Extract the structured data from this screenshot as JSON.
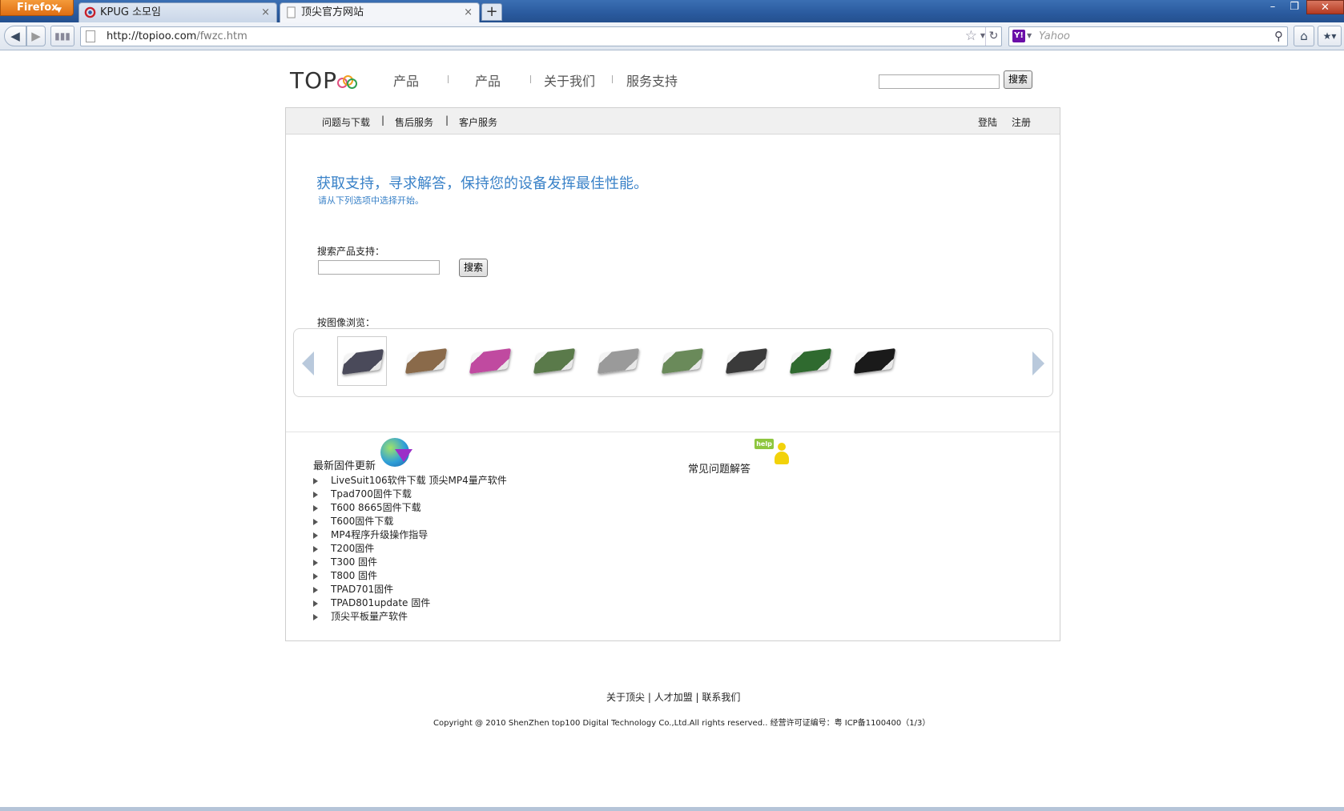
{
  "browser": {
    "menu_button": "Firefox",
    "tabs": [
      {
        "title": "KPUG 소모임",
        "active": false
      },
      {
        "title": "顶尖官方网站",
        "active": true
      }
    ],
    "new_tab": "+",
    "url_host": "http://topioo.com",
    "url_path": "/fwzc.htm",
    "search_engine": "Y!",
    "search_placeholder": "Yahoo",
    "window_controls": {
      "minimize": "–",
      "maximize": "❐",
      "close": "✕"
    }
  },
  "header": {
    "logo": "TOP",
    "nav": [
      "产品",
      "产品",
      "关于我们",
      "服务支持"
    ],
    "search_button": "搜索"
  },
  "subnav": {
    "items": [
      "问题与下载",
      "售后服务",
      "客户服务"
    ],
    "separator": "|",
    "login": "登陆",
    "register": "注册"
  },
  "main": {
    "headline": "获取支持，寻求解答，保持您的设备发挥最佳性能。",
    "subheadline": "请从下列选项中选择开始。",
    "search_label": "搜索产品支持：",
    "search_button": "搜索",
    "browse_label": "按图像浏览："
  },
  "carousel": {
    "thumbs": [
      {
        "color": "#4a4a5a",
        "selected": true
      },
      {
        "color": "#8a6a4a",
        "selected": false
      },
      {
        "color": "#c04aa0",
        "selected": false
      },
      {
        "color": "#5a7a4a",
        "selected": false
      },
      {
        "color": "#9a9a9a",
        "selected": false
      },
      {
        "color": "#6a8a5a",
        "selected": false
      },
      {
        "color": "#3a3a3a",
        "selected": false
      },
      {
        "color": "#2f6a2f",
        "selected": false
      },
      {
        "color": "#1a1a1a",
        "selected": false
      }
    ]
  },
  "firmware": {
    "title": "最新固件更新",
    "items": [
      "LiveSuit106软件下载 顶尖MP4量产软件",
      "Tpad700固件下载",
      "T600 8665固件下载",
      "T600固件下载",
      "MP4程序升级操作指导",
      "T200固件",
      "T300 固件",
      "T800 固件",
      "TPAD701固件",
      "TPAD801update 固件",
      "顶尖平板量产软件"
    ]
  },
  "faq": {
    "title": "常见问题解答",
    "help_badge": "help"
  },
  "footer": {
    "links": [
      "关于顶尖",
      "人才加盟",
      "联系我们"
    ],
    "separator": " | ",
    "copyright": "Copyright @ 2010 ShenZhen top100 Digital Technology Co.,Ltd.All rights reserved.. 经营许可证编号：粤 ICP备1100400（1/3）"
  }
}
